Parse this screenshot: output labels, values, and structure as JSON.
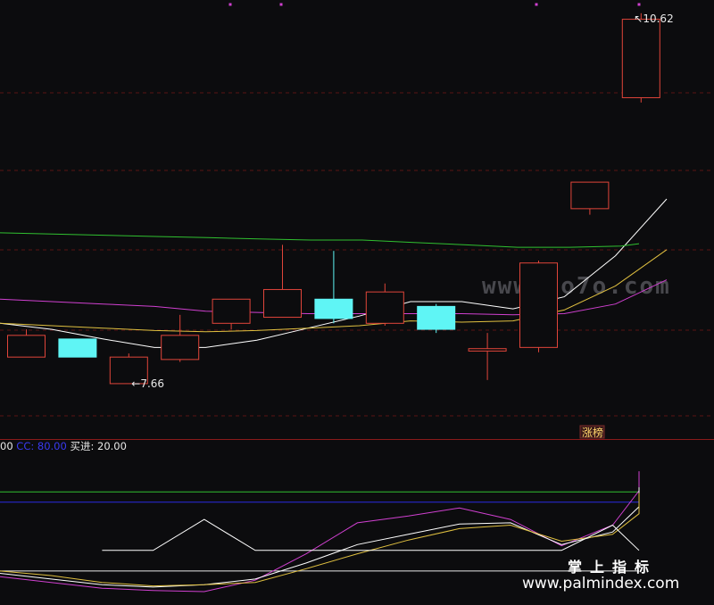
{
  "chart_data": [
    {
      "type": "candlestick",
      "title": "",
      "ylim": [
        7.2,
        10.75
      ],
      "candles": [
        {
          "open": 8.0,
          "high": 8.05,
          "low": 7.82,
          "close": 7.82,
          "color": "red"
        },
        {
          "open": 7.97,
          "high": 7.97,
          "low": 7.82,
          "close": 7.82,
          "color": "cyan"
        },
        {
          "open": 7.82,
          "high": 7.85,
          "low": 7.6,
          "close": 7.6,
          "color": "red"
        },
        {
          "open": 7.8,
          "high": 8.17,
          "low": 7.78,
          "close": 8.0,
          "color": "red"
        },
        {
          "open": 8.1,
          "high": 8.25,
          "low": 8.05,
          "close": 8.3,
          "color": "red"
        },
        {
          "open": 8.15,
          "high": 8.75,
          "low": 8.15,
          "close": 8.38,
          "color": "red"
        },
        {
          "open": 8.3,
          "high": 8.7,
          "low": 8.1,
          "close": 8.14,
          "color": "cyan"
        },
        {
          "open": 8.1,
          "high": 8.43,
          "low": 8.08,
          "close": 8.36,
          "color": "red"
        },
        {
          "open": 8.24,
          "high": 8.26,
          "low": 8.02,
          "close": 8.05,
          "color": "cyan"
        },
        {
          "open": 7.89,
          "high": 8.02,
          "low": 7.63,
          "close": 7.87,
          "color": "red"
        },
        {
          "open": 7.9,
          "high": 8.62,
          "low": 7.86,
          "close": 8.6,
          "color": "red"
        },
        {
          "open": 9.05,
          "high": 9.27,
          "low": 9.0,
          "close": 9.27,
          "color": "red"
        },
        {
          "open": 9.97,
          "high": 10.67,
          "low": 9.93,
          "close": 10.62,
          "color": "red"
        }
      ],
      "moving_averages": [
        {
          "color": "#ffffff",
          "values": [
            8.1,
            8.05,
            7.97,
            7.9,
            7.9,
            7.96,
            8.06,
            8.16,
            8.28,
            8.28,
            8.22,
            8.32,
            8.66,
            9.13
          ]
        },
        {
          "color": "#e0c040",
          "values": [
            8.1,
            8.08,
            8.06,
            8.04,
            8.03,
            8.04,
            8.06,
            8.08,
            8.12,
            8.11,
            8.12,
            8.21,
            8.41,
            8.71
          ]
        },
        {
          "color": "#d040d0",
          "values": [
            8.3,
            8.28,
            8.26,
            8.24,
            8.2,
            8.19,
            8.18,
            8.18,
            8.18,
            8.18,
            8.17,
            8.18,
            8.26,
            8.46
          ]
        },
        {
          "color": "#30c030",
          "values": [
            8.85,
            8.84,
            8.83,
            8.82,
            8.81,
            8.8,
            8.79,
            8.79,
            8.77,
            8.75,
            8.73,
            8.73,
            8.74,
            8.76
          ]
        }
      ],
      "annotations": [
        {
          "text": "7.66",
          "candle": 2,
          "value": 7.6
        },
        {
          "text": "10.62",
          "candle": 12,
          "value": 10.67
        }
      ],
      "badge": "涨榜"
    },
    {
      "type": "line",
      "title": "",
      "legend": {
        "prefix": "00",
        "items": [
          "CC: 80.00",
          "买进: 20.00"
        ]
      },
      "ylim": [
        -5,
        125
      ],
      "reference_lines": [
        {
          "value": 80.0,
          "color": "#2a2ae0"
        },
        {
          "value": 20.0,
          "color": "#e8e8e8"
        },
        {
          "value": 89.0,
          "color": "#30c030"
        }
      ],
      "series": [
        {
          "color": "#d040d0",
          "values": [
            15,
            10,
            5,
            3,
            2,
            12,
            35,
            62,
            68,
            75,
            65,
            42,
            60,
            90,
            107
          ]
        },
        {
          "color": "#ffffff",
          "values": [
            18,
            13,
            8,
            6,
            8,
            13,
            27,
            43,
            52,
            61,
            62,
            43,
            54,
            76,
            93
          ]
        },
        {
          "color": "#e0c040",
          "values": [
            20,
            16,
            10,
            7,
            8,
            10,
            22,
            35,
            47,
            57,
            60,
            46,
            52,
            70,
            88
          ]
        },
        {
          "color": "#ffffff",
          "step": true,
          "values": [
            null,
            null,
            38,
            38,
            65,
            38,
            38,
            38,
            38,
            38,
            38,
            38,
            60,
            38,
            38
          ]
        }
      ]
    }
  ],
  "watermarks": {
    "site_code": "www.6o7o.com",
    "brand_cn": "掌上指标",
    "brand_url": "www.palmindex.com"
  }
}
